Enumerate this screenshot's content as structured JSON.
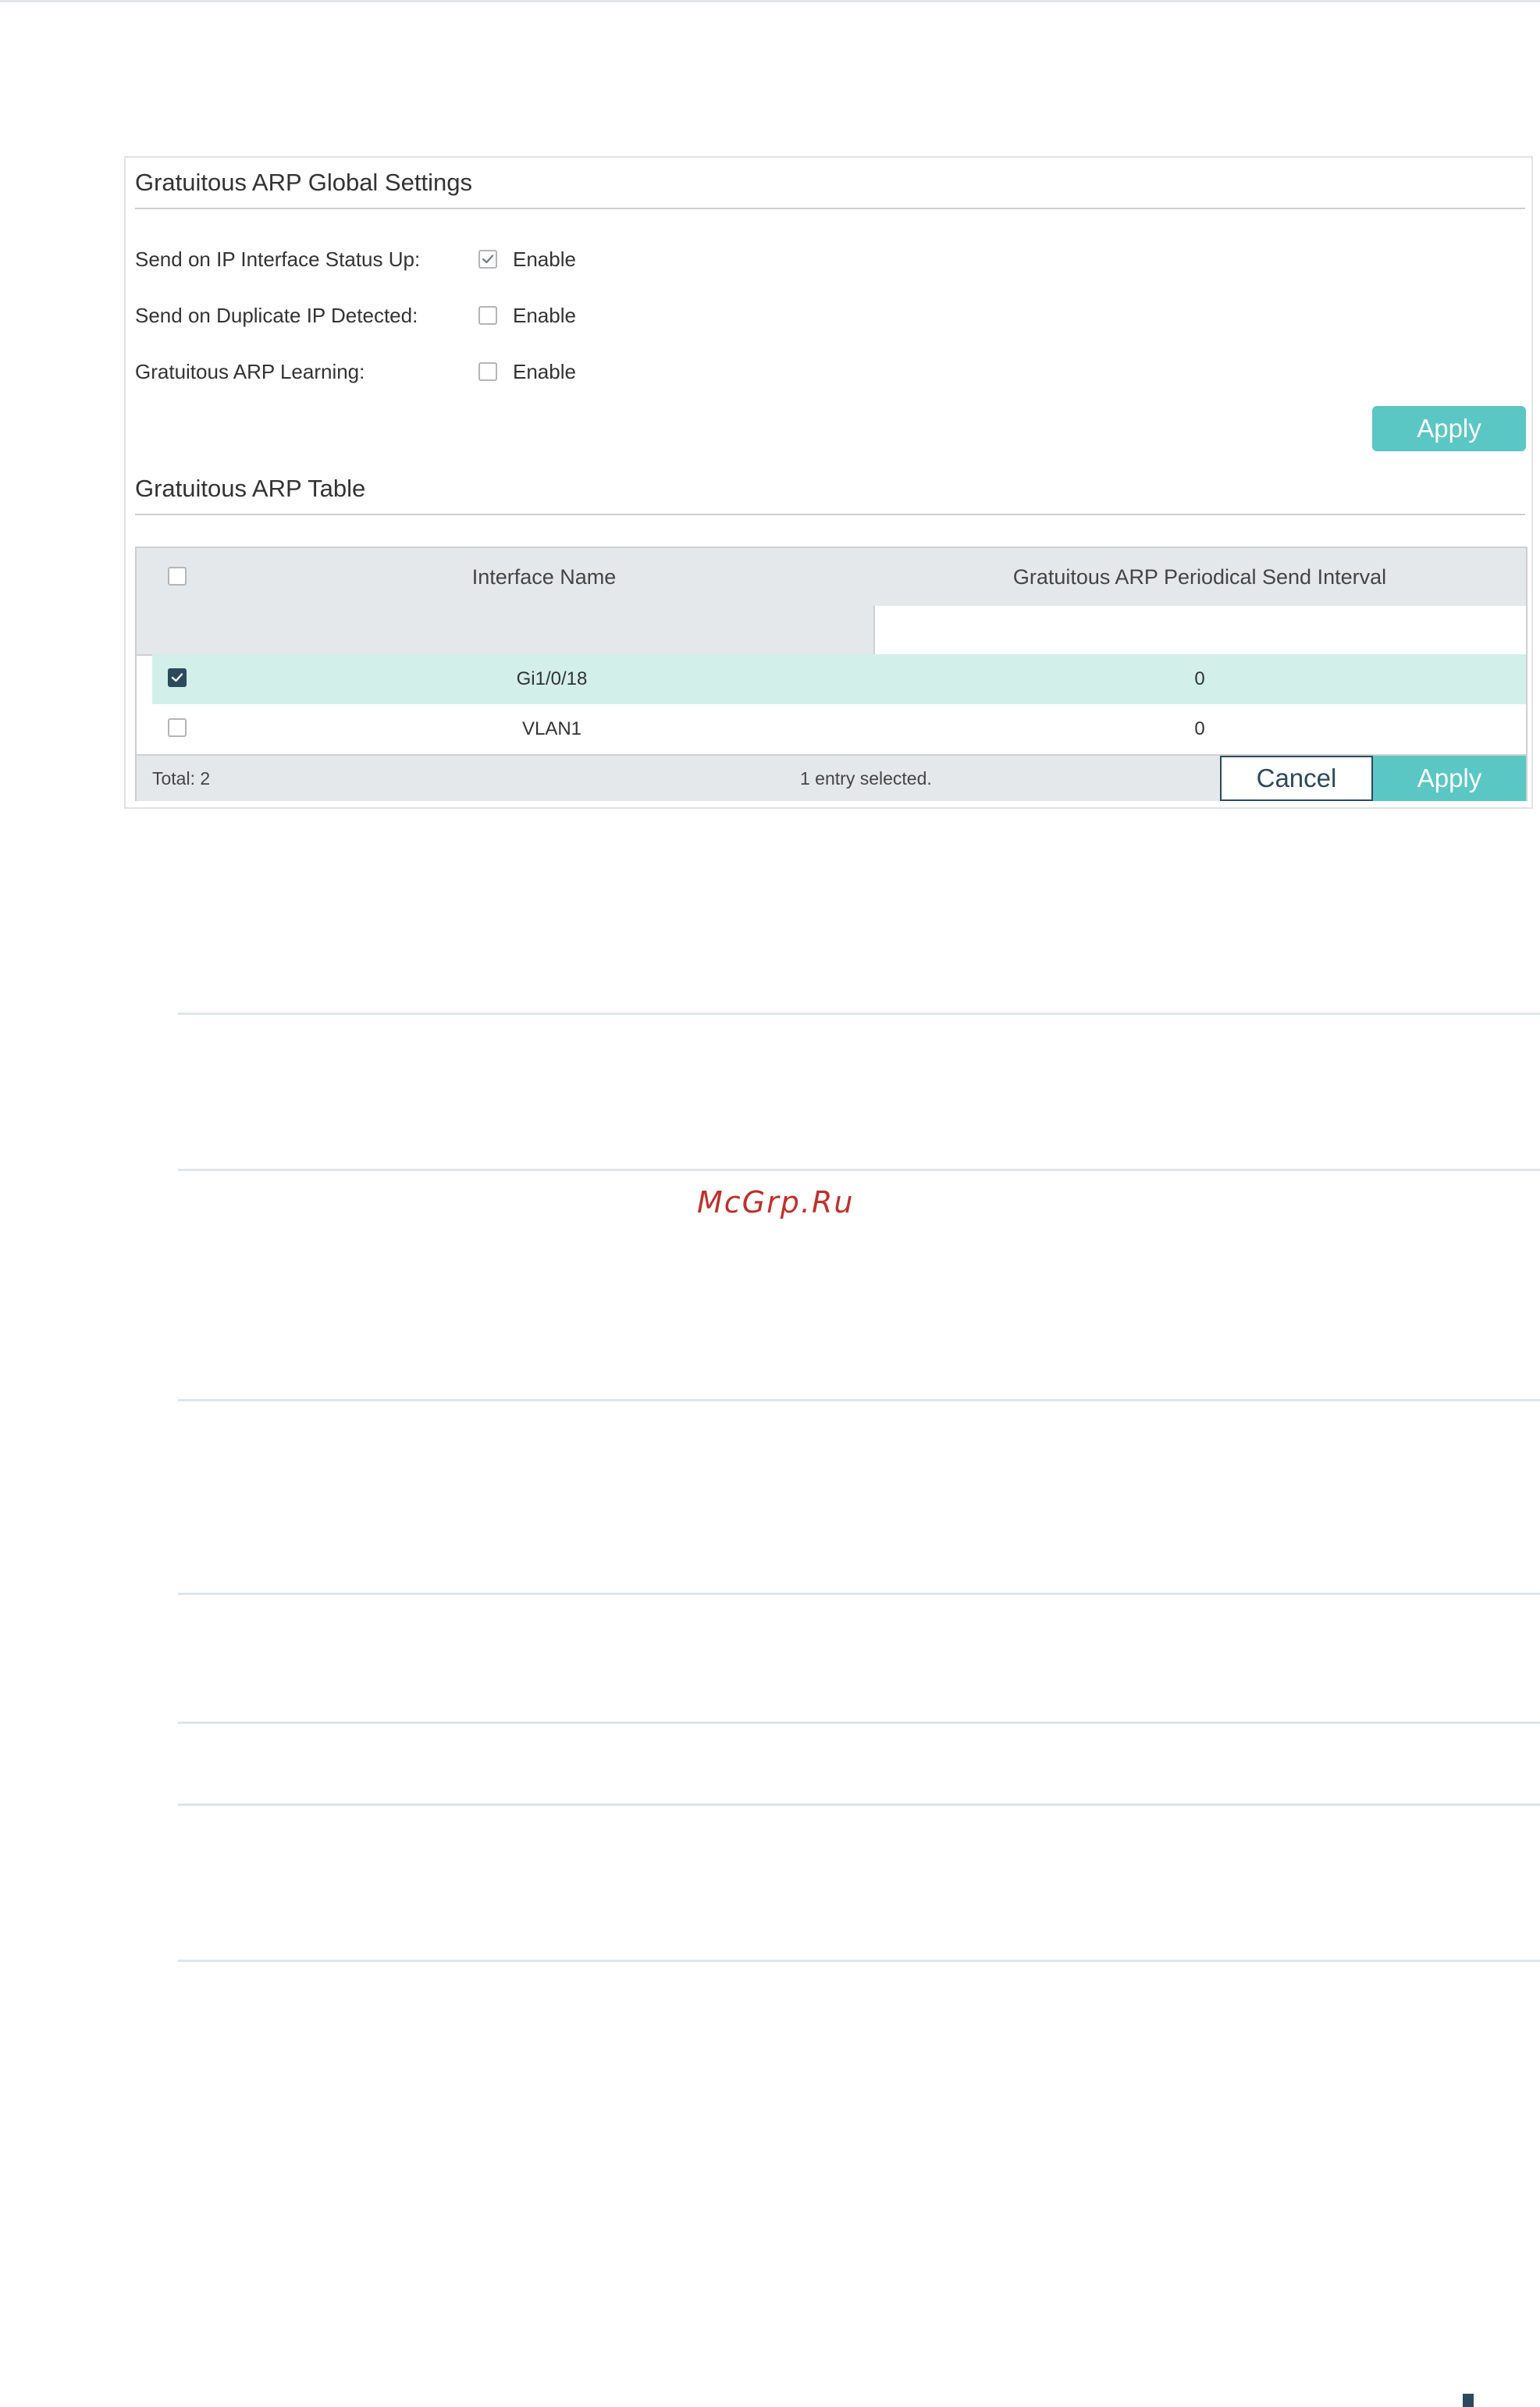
{
  "global_settings": {
    "title": "Gratuitous ARP Global Settings",
    "rows": [
      {
        "label": "Send on IP Interface Status Up:",
        "option": "Enable",
        "checked": true
      },
      {
        "label": "Send on Duplicate IP Detected:",
        "option": "Enable",
        "checked": false
      },
      {
        "label": "Gratuitous ARP Learning:",
        "option": "Enable",
        "checked": false
      }
    ],
    "apply_label": "Apply"
  },
  "table": {
    "title": "Gratuitous ARP Table",
    "columns": [
      "Interface Name",
      "Gratuitous ARP Periodical Send Interval"
    ],
    "rows": [
      {
        "interface": "Gi1/0/18",
        "interval": "0",
        "selected": true
      },
      {
        "interface": "VLAN1",
        "interval": "0",
        "selected": false
      }
    ],
    "footer": {
      "total": "Total: 2",
      "selected_text": "1 entry selected.",
      "cancel_label": "Cancel",
      "apply_label": "Apply"
    }
  },
  "watermark": "McGrp.Ru",
  "colors": {
    "accent": "#5bc7c4",
    "dark": "#2c4a5e",
    "selected_row": "#d3efe9",
    "header_bg": "#e4e8ea",
    "watermark": "#c0302a"
  }
}
